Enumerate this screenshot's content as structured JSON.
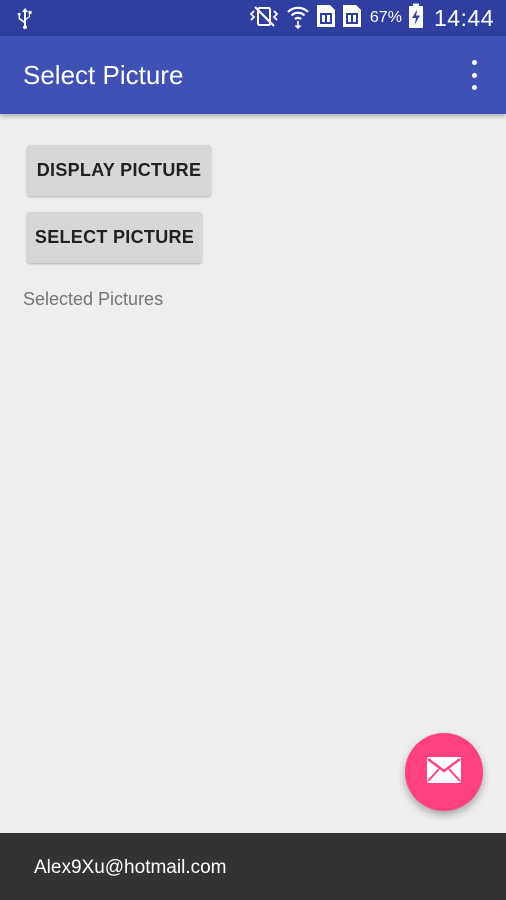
{
  "status_bar": {
    "battery_percent": "67%",
    "time": "14:44",
    "icons": [
      "usb-icon",
      "vibrate-icon",
      "wifi-icon",
      "sim1-icon",
      "sim2-icon",
      "battery-charging-icon"
    ]
  },
  "app_bar": {
    "title": "Select Picture",
    "overflow_icon": "more-vert-icon"
  },
  "main": {
    "display_button_label": "DISPLAY PICTURE",
    "select_button_label": "SELECT PICTURE",
    "selected_label": "Selected Pictures"
  },
  "fab": {
    "icon": "email-icon"
  },
  "bottom_bar": {
    "text": "Alex9Xu@hotmail.com"
  },
  "colors": {
    "status_bar": "#303f9f",
    "primary": "#3f51b5",
    "accent": "#ff4081",
    "background": "#eeeeee",
    "bottom_bar": "#333333"
  }
}
